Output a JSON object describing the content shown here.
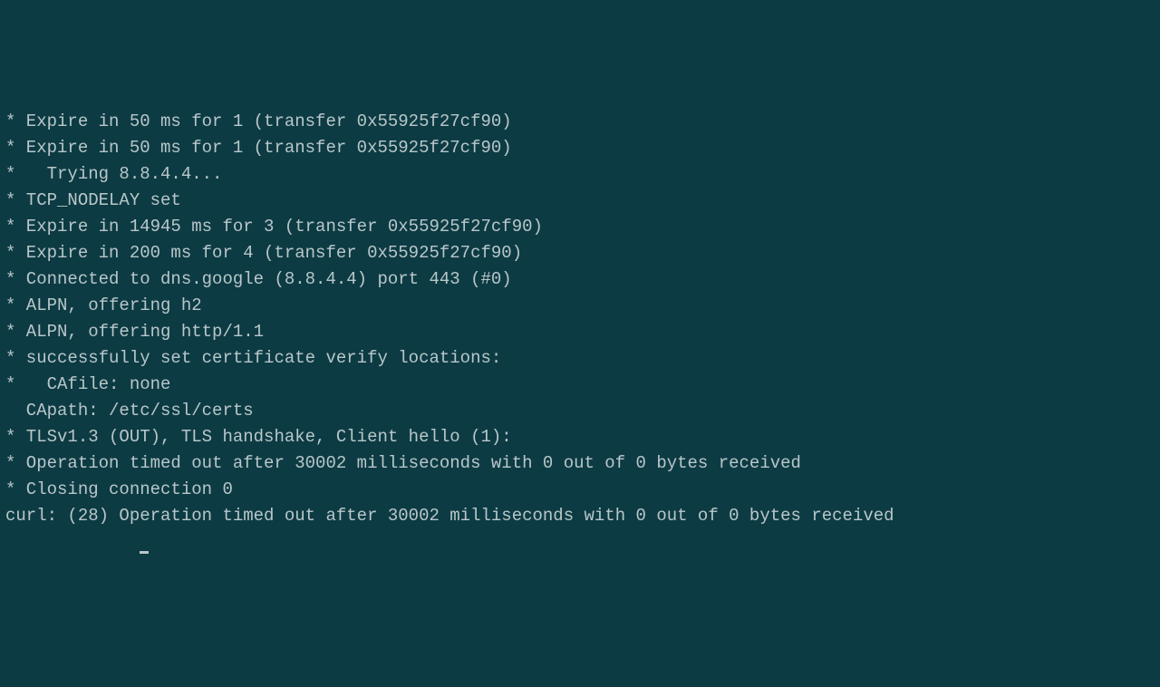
{
  "terminal": {
    "lines": [
      "* Expire in 50 ms for 1 (transfer 0x55925f27cf90)",
      "* Expire in 50 ms for 1 (transfer 0x55925f27cf90)",
      "*   Trying 8.8.4.4...",
      "* TCP_NODELAY set",
      "* Expire in 14945 ms for 3 (transfer 0x55925f27cf90)",
      "* Expire in 200 ms for 4 (transfer 0x55925f27cf90)",
      "* Connected to dns.google (8.8.4.4) port 443 (#0)",
      "* ALPN, offering h2",
      "* ALPN, offering http/1.1",
      "* successfully set certificate verify locations:",
      "*   CAfile: none",
      "  CApath: /etc/ssl/certs",
      "* TLSv1.3 (OUT), TLS handshake, Client hello (1):",
      "* Operation timed out after 30002 milliseconds with 0 out of 0 bytes received",
      "* Closing connection 0",
      "curl: (28) Operation timed out after 30002 milliseconds with 0 out of 0 bytes received"
    ]
  }
}
